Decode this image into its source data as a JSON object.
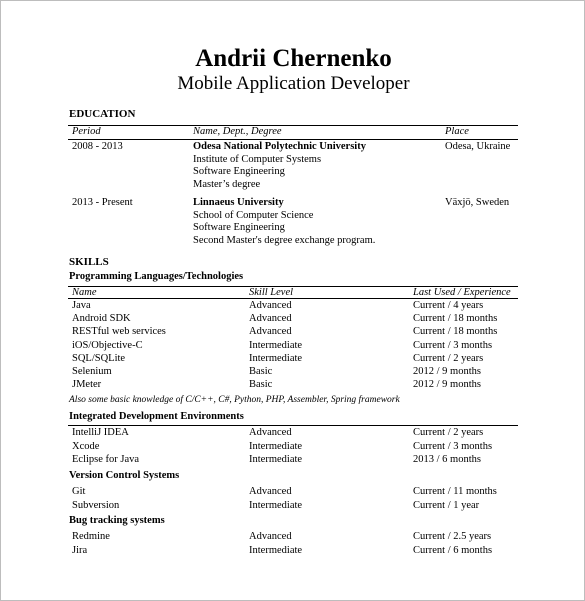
{
  "header": {
    "name": "Andrii Chernenko",
    "title": "Mobile Application Developer"
  },
  "education": {
    "heading": "EDUCATION",
    "columns": [
      "Period",
      "Name, Dept., Degree",
      "Place"
    ],
    "entries": [
      {
        "period": "2008 - 2013",
        "institution": "Odesa National Polytechnic University",
        "lines": [
          "Institute of Computer Systems",
          "Software Engineering",
          "Master’s degree"
        ],
        "place": "Odesa, Ukraine"
      },
      {
        "period": "2013 - Present",
        "institution": "Linnaeus University",
        "lines": [
          "School of Computer Science",
          "Software Engineering",
          "Second Master's degree exchange program."
        ],
        "place": "Växjö, Sweden"
      }
    ]
  },
  "skills": {
    "heading": "SKILLS",
    "columns": [
      "Name",
      "Skill Level",
      "Last Used / Experience"
    ],
    "groups": [
      {
        "title": "Programming Languages/Technologies",
        "rows": [
          {
            "name": "Java",
            "level": "Advanced",
            "experience": "Current / 4 years"
          },
          {
            "name": "Android SDK",
            "level": "Advanced",
            "experience": "Current / 18 months"
          },
          {
            "name": "RESTful web services",
            "level": "Advanced",
            "experience": "Current / 18 months"
          },
          {
            "name": "iOS/Objective-C",
            "level": "Intermediate",
            "experience": "Current / 3 months"
          },
          {
            "name": "SQL/SQLite",
            "level": "Intermediate",
            "experience": "Current / 2 years"
          },
          {
            "name": "Selenium",
            "level": "Basic",
            "experience": "2012 / 9 months"
          },
          {
            "name": "JMeter",
            "level": "Basic",
            "experience": "2012 / 9 months"
          }
        ],
        "note": "Also some basic knowledge of C/C++, C#, Python, PHP, Assembler, Spring framework"
      },
      {
        "title": "Integrated Development Environments",
        "rows": [
          {
            "name": "IntelliJ IDEA",
            "level": "Advanced",
            "experience": "Current / 2 years"
          },
          {
            "name": "Xcode",
            "level": "Intermediate",
            "experience": "Current / 3 months"
          },
          {
            "name": "Eclipse for Java",
            "level": "Intermediate",
            "experience": "2013 / 6 months"
          }
        ]
      },
      {
        "title": "Version Control Systems",
        "rows": [
          {
            "name": "Git",
            "level": "Advanced",
            "experience": "Current / 11 months"
          },
          {
            "name": "Subversion",
            "level": "Intermediate",
            "experience": "Current / 1 year"
          }
        ]
      },
      {
        "title": "Bug tracking systems",
        "rows": [
          {
            "name": "Redmine",
            "level": "Advanced",
            "experience": "Current / 2.5 years"
          },
          {
            "name": "Jira",
            "level": "Intermediate",
            "experience": "Current / 6 months"
          }
        ]
      }
    ]
  }
}
